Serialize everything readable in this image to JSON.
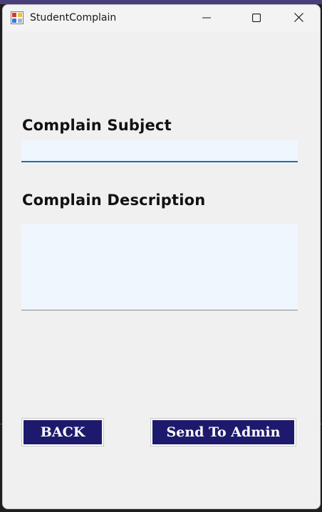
{
  "window": {
    "title": "StudentComplain",
    "controls": {
      "minimize_icon": "minimize-icon",
      "maximize_icon": "maximize-icon",
      "close_icon": "close-icon"
    }
  },
  "form": {
    "subject_label": "Complain Subject",
    "subject_value": "",
    "description_label": "Complain Description",
    "description_value": ""
  },
  "buttons": {
    "back_label": "BACK",
    "send_label": "Send To Admin"
  },
  "colors": {
    "button_bg": "#1d1a6e",
    "input_bg": "#f0f6fd",
    "input_focus_border": "#1a6fb6",
    "window_bg": "#f0f0f0"
  }
}
